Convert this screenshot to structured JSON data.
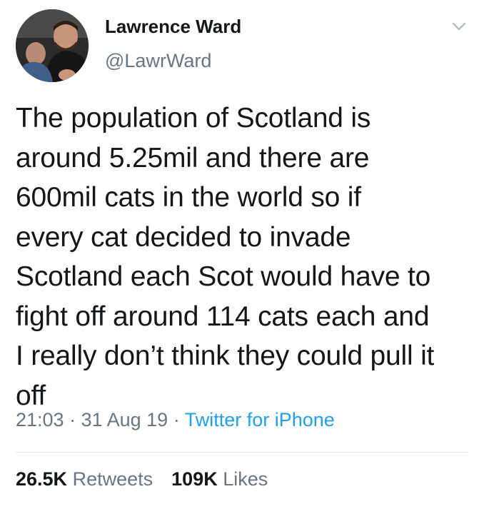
{
  "author": {
    "name": "Lawrence Ward",
    "handle": "@LawrWard"
  },
  "tweet": {
    "lines": [
      "The population of Scotland is",
      "around 5.25mil and there are",
      "600mil cats in the world so if",
      "every cat decided to invade",
      "Scotland each Scot would have to",
      "fight off around 114 cats each and",
      "I really don’t think they could pull it",
      "off"
    ]
  },
  "meta": {
    "time": "21:03",
    "separator1": " · ",
    "date": "31 Aug 19",
    "separator2": " · ",
    "source": "Twitter for iPhone"
  },
  "stats": {
    "retweets_count": "26.5K",
    "retweets_label": "Retweets",
    "likes_count": "109K",
    "likes_label": "Likes"
  },
  "colors": {
    "text": "#14171a",
    "secondary": "#657786",
    "link": "#1da1f2",
    "divider": "#e1e8ed"
  },
  "icons": {
    "caret": "chevron-down-icon",
    "avatar": "avatar-photo"
  }
}
